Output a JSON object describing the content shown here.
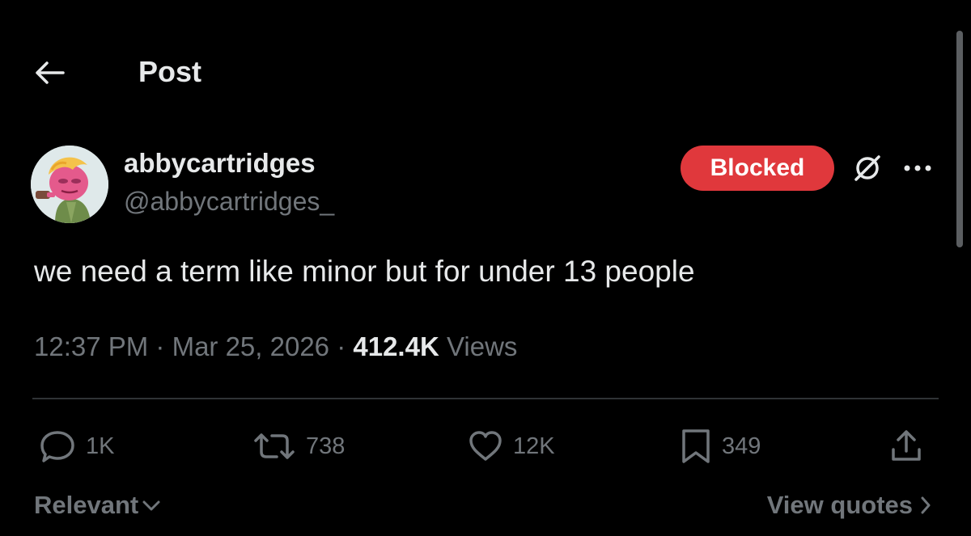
{
  "header": {
    "title": "Post"
  },
  "post": {
    "author": {
      "display_name": "abbycartridges",
      "handle": "@abbycartridges_"
    },
    "follow_status": "Blocked",
    "text": "we need a term like minor but for under 13 people",
    "time": "12:37 PM",
    "date": "Mar 25, 2026",
    "views_count": "412.4K",
    "views_label": "Views",
    "separator": " · "
  },
  "actions": {
    "replies": "1K",
    "reposts": "738",
    "likes": "12K",
    "bookmarks": "349"
  },
  "footer": {
    "sort_label": "Relevant",
    "view_quotes_label": "View quotes"
  },
  "colors": {
    "background": "#000000",
    "text_primary": "#e7e9ea",
    "text_secondary": "#71767b",
    "blocked_red": "#e0383c",
    "divider": "#2f3336"
  },
  "icons": {
    "back": "arrow-left-icon",
    "grok": "grok-icon",
    "more": "more-horizontal-icon",
    "reply": "reply-icon",
    "repost": "repost-icon",
    "like": "heart-icon",
    "bookmark": "bookmark-icon",
    "share": "share-icon"
  }
}
